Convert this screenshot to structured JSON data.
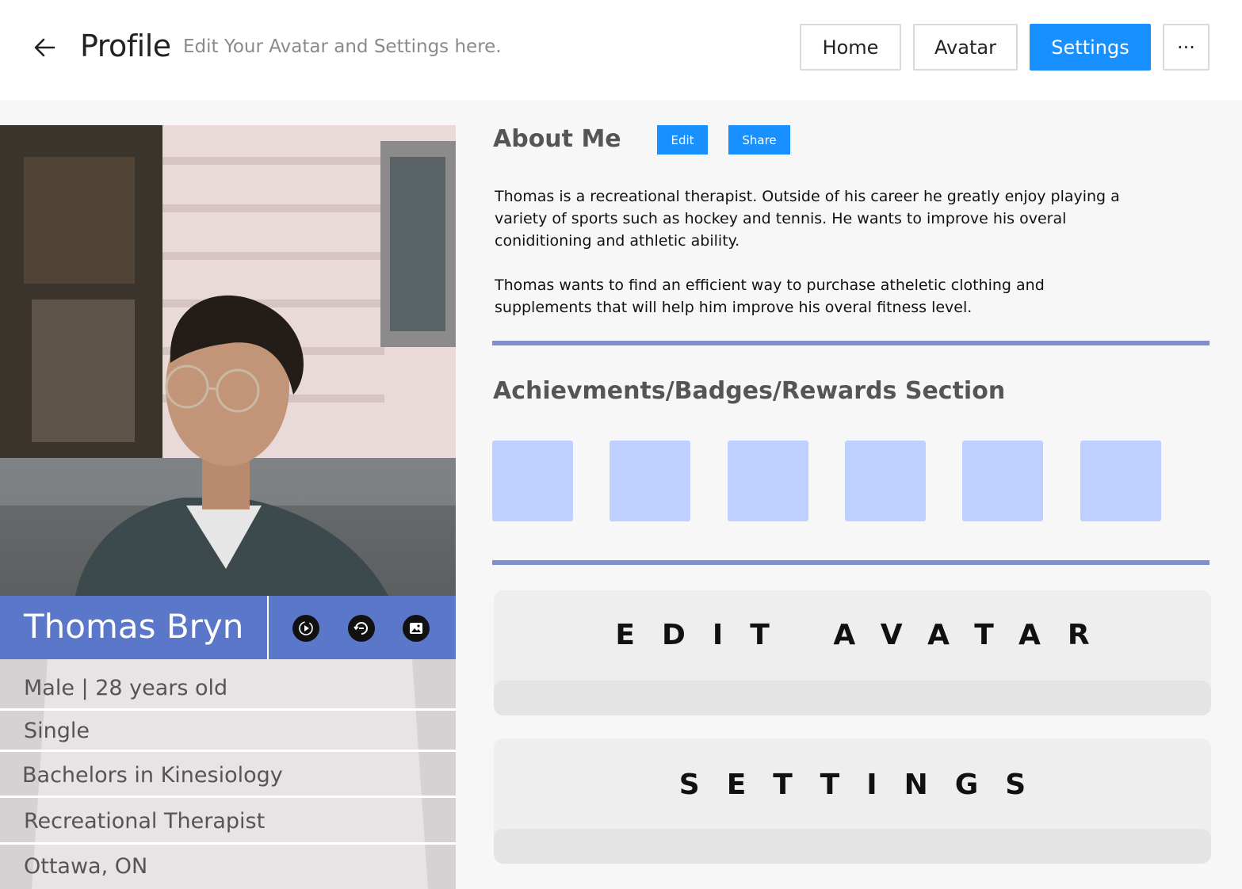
{
  "header": {
    "title": "Profile",
    "subtitle": "Edit Your Avatar and Settings here.",
    "nav": [
      {
        "label": "Home"
      },
      {
        "label": "Avatar"
      },
      {
        "label": "Settings",
        "active": true
      }
    ],
    "more_label": "···"
  },
  "profile": {
    "name": "Thomas Bryn",
    "icons": [
      "play-circle-icon",
      "timer-icon",
      "image-icon"
    ],
    "details": [
      "Male | 28 years old",
      "Single",
      "Bachelors in Kinesiology",
      "Recreational Therapist",
      "Ottawa, ON"
    ]
  },
  "about": {
    "title": "About Me",
    "edit_label": "Edit",
    "share_label": "Share",
    "paragraph1_line1": "Thomas is a recreational therapist. Outside of his career he greatly enjoy playing a",
    "paragraph1_line2": "variety of sports such as hockey and tennis. He  wants to improve his overal",
    "paragraph1_line3": "coniditioning and athletic ability.",
    "paragraph2_line1": "Thomas wants to find an efficient way to purchase atheletic clothing and",
    "paragraph2_line2": "supplements that will help him improve his overal fitness level."
  },
  "achievements": {
    "title": "Achievments/Badges/Rewards Section",
    "badge_count": 6
  },
  "actions": {
    "edit_avatar": "EDIT AVATAR",
    "settings": "SETTINGS"
  },
  "colors": {
    "accent": "#1890ff",
    "name_bar": "#5b77c9",
    "rule": "#7f8ed0",
    "badge": "#bed0ff"
  }
}
